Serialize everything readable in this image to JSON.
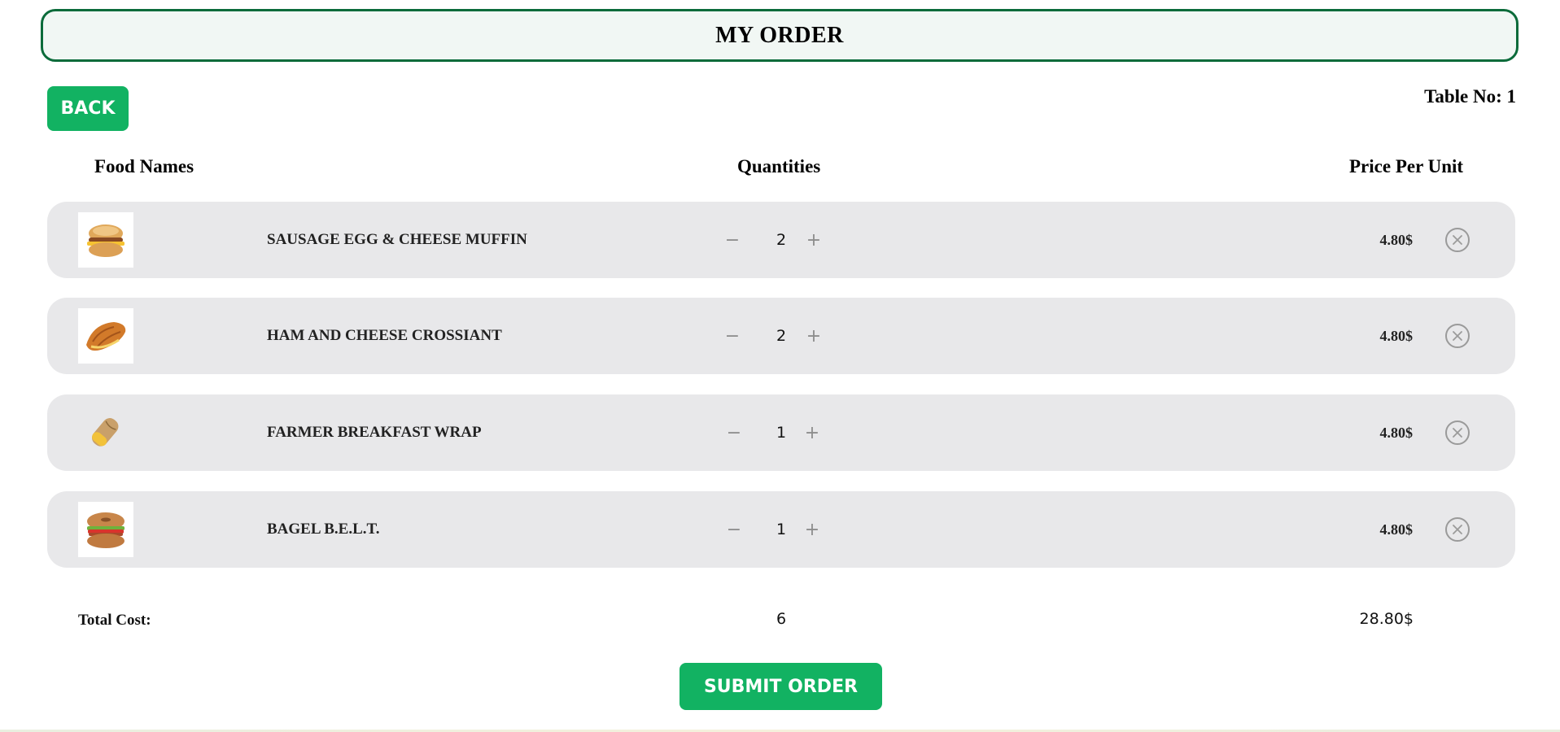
{
  "header": {
    "title": "MY ORDER"
  },
  "nav": {
    "back_label": "BACK",
    "table_no": "Table No: 1"
  },
  "columns": {
    "food": "Food Names",
    "qty": "Quantities",
    "price": "Price Per Unit"
  },
  "items": [
    {
      "name": "SAUSAGE EGG & CHEESE MUFFIN",
      "qty": "2",
      "price": "4.80$",
      "image_icon": "muffin-sandwich-icon"
    },
    {
      "name": "HAM AND CHEESE CROSSIANT",
      "qty": "2",
      "price": "4.80$",
      "image_icon": "croissant-icon"
    },
    {
      "name": "FARMER BREAKFAST WRAP",
      "qty": "1",
      "price": "4.80$",
      "image_icon": "wrap-icon"
    },
    {
      "name": "BAGEL B.E.L.T.",
      "qty": "1",
      "price": "4.80$",
      "image_icon": "bagel-icon"
    }
  ],
  "controls": {
    "minus": "−",
    "plus": "+"
  },
  "totals": {
    "label": "Total Cost:",
    "qty": "6",
    "price": "28.80$"
  },
  "submit_label": "SUBMIT ORDER",
  "colors": {
    "accent_green": "#12b262",
    "header_border": "#0b6b3a",
    "header_bg": "#f1f7f4",
    "row_bg": "#e8e8ea"
  }
}
